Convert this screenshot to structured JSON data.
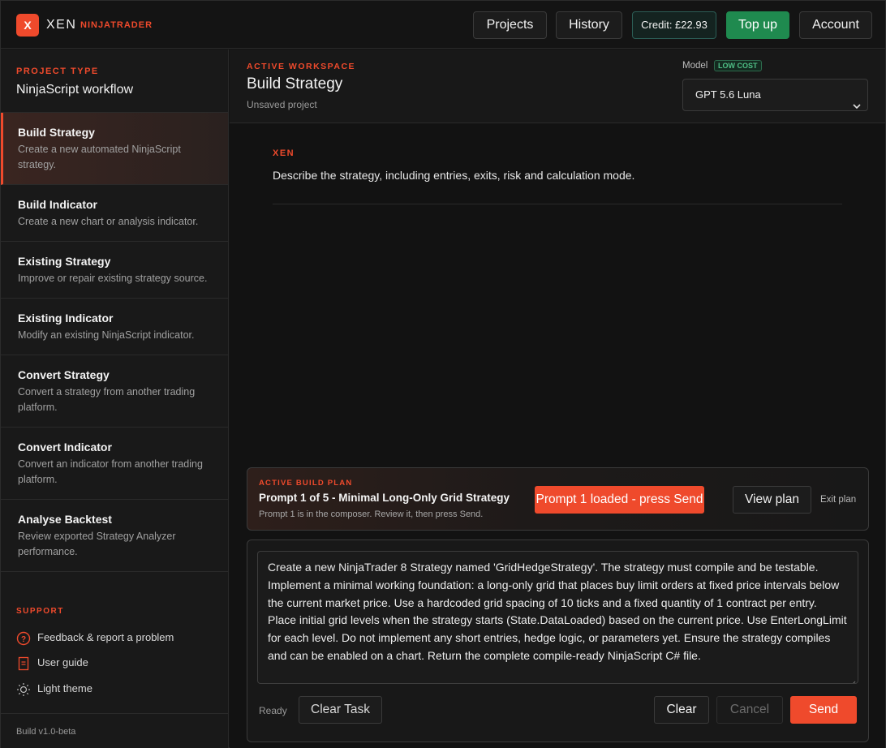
{
  "topbar": {
    "logo": "X",
    "brand": "XEN",
    "brand_sub": "NINJATRADER",
    "projects": "Projects",
    "history": "History",
    "credit": "Credit: £22.93",
    "topup": "Top up",
    "account": "Account"
  },
  "sidebar": {
    "project_type_label": "PROJECT TYPE",
    "project_type_value": "NinjaScript workflow",
    "items": [
      {
        "title": "Build Strategy",
        "desc": "Create a new automated NinjaScript strategy."
      },
      {
        "title": "Build Indicator",
        "desc": "Create a new chart or analysis indicator."
      },
      {
        "title": "Existing Strategy",
        "desc": "Improve or repair existing strategy source."
      },
      {
        "title": "Existing Indicator",
        "desc": "Modify an existing NinjaScript indicator."
      },
      {
        "title": "Convert Strategy",
        "desc": "Convert a strategy from another trading platform."
      },
      {
        "title": "Convert Indicator",
        "desc": "Convert an indicator from another trading platform."
      },
      {
        "title": "Analyse Backtest",
        "desc": "Review exported Strategy Analyzer performance."
      }
    ],
    "support_label": "SUPPORT",
    "support": {
      "feedback": "Feedback & report a problem",
      "guide": "User guide",
      "theme": "Light theme"
    },
    "version": "Build v1.0-beta"
  },
  "workspace": {
    "label": "ACTIVE WORKSPACE",
    "title": "Build Strategy",
    "subtitle": "Unsaved project",
    "model_label": "Model",
    "model_badge": "LOW COST",
    "model_value": "GPT 5.6 Luna"
  },
  "chat": {
    "sender": "XEN",
    "message": "Describe the strategy, including entries, exits, risk and calculation mode."
  },
  "plan": {
    "label": "ACTIVE BUILD PLAN",
    "title": "Prompt 1 of 5 - Minimal Long-Only Grid Strategy",
    "subtitle": "Prompt 1 is in the composer. Review it, then press Send.",
    "loaded_button": "Prompt 1 loaded - press Send",
    "view_button": "View plan",
    "exit": "Exit plan"
  },
  "composer": {
    "text": "Create a new NinjaTrader 8 Strategy named 'GridHedgeStrategy'. The strategy must compile and be testable. Implement a minimal working foundation: a long-only grid that places buy limit orders at fixed price intervals below the current market price. Use a hardcoded grid spacing of 10 ticks and a fixed quantity of 1 contract per entry. Place initial grid levels when the strategy starts (State.DataLoaded) based on the current price. Use EnterLongLimit for each level. Do not implement any short entries, hedge logic, or parameters yet. Ensure the strategy compiles and can be enabled on a chart. Return the complete compile-ready NinjaScript C# file.",
    "status": "Ready",
    "clear_task": "Clear Task",
    "clear": "Clear",
    "cancel": "Cancel",
    "send": "Send"
  },
  "colors": {
    "accent": "#ef4a2c",
    "topup": "#1f8a4f",
    "background": "#141414"
  }
}
